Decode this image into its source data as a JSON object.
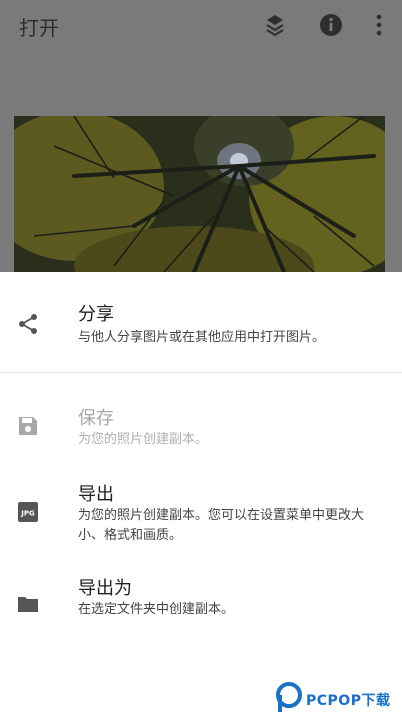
{
  "toolbar": {
    "title": "打开",
    "icons": [
      "looks-icon",
      "info-icon",
      "more-vert-icon"
    ]
  },
  "sheet": {
    "items": [
      {
        "title": "分享",
        "desc": "与他人分享图片或在其他应用中打开图片。",
        "icon": "share-icon",
        "enabled": true
      },
      {
        "title": "保存",
        "desc": "为您的照片创建副本。",
        "icon": "save-icon",
        "enabled": false
      },
      {
        "title": "导出",
        "desc": "为您的照片创建副本。您可以在设置菜单中更改大小、格式和画质。",
        "icon": "jpg-icon",
        "icon_text": "JPG",
        "enabled": true
      },
      {
        "title": "导出为",
        "desc": "在选定文件夹中创建副本。",
        "icon": "folder-icon",
        "enabled": true
      }
    ]
  },
  "watermark": {
    "text": "PCPOP下载"
  },
  "colors": {
    "scrim": "#7a7a7a",
    "watermark": "#1a6fc9",
    "icon": "#555555"
  }
}
